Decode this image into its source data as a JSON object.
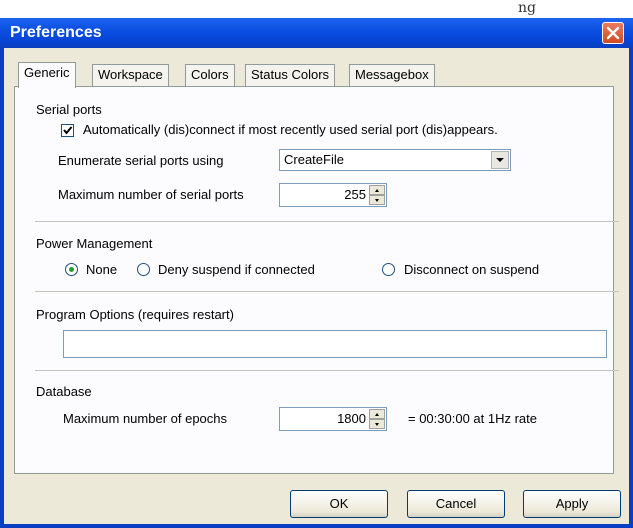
{
  "page_fragment": "ng",
  "window": {
    "title": "Preferences"
  },
  "tabs": [
    "Generic",
    "Workspace",
    "Colors",
    "Status Colors",
    "Messagebox"
  ],
  "serial": {
    "section": "Serial ports",
    "auto_checkbox_label": "Automatically (dis)connect if most recently used serial port (dis)appears.",
    "auto_checked": true,
    "enumerate_label": "Enumerate serial ports using",
    "enumerate_value": "CreateFile",
    "max_label": "Maximum number of serial ports",
    "max_value": "255"
  },
  "power": {
    "section": "Power Management",
    "options": [
      "None",
      "Deny suspend if connected",
      "Disconnect on suspend"
    ],
    "selected": "None"
  },
  "program": {
    "section": "Program Options (requires restart)",
    "value": ""
  },
  "database": {
    "section": "Database",
    "epochs_label": "Maximum number of epochs",
    "epochs_value": "1800",
    "epochs_info": "= 00:30:00 at 1Hz rate"
  },
  "buttons": {
    "ok": "OK",
    "cancel": "Cancel",
    "apply": "Apply"
  },
  "colors": {
    "titlebar": "#0b4fe0",
    "client": "#ece9d8",
    "panel": "#fcfcfe",
    "close": "#d24a22"
  }
}
